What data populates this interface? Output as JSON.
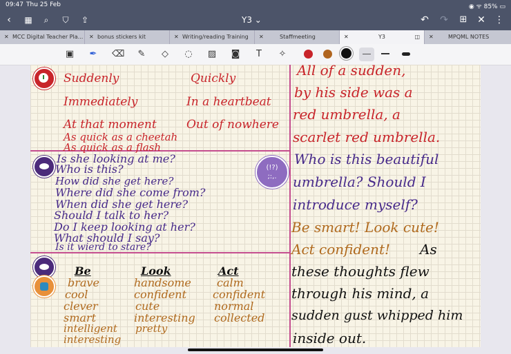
{
  "status": {
    "time": "09:47",
    "date": "Thu 25 Feb",
    "battery": "85%"
  },
  "toolbar": {
    "title": "Y3 ⌄"
  },
  "tabs": [
    {
      "label": "MCC Digital Teacher Pla..."
    },
    {
      "label": "bonus stickers kit"
    },
    {
      "label": "Writing/reading Training"
    },
    {
      "label": "Staffmeeting"
    },
    {
      "label": "Y3"
    },
    {
      "label": "MPQML NOTES"
    }
  ],
  "colors": {
    "red": "#c8242a",
    "brown": "#b0651f",
    "black": "#111111"
  },
  "left": {
    "openers_col1": [
      "Suddenly",
      "Immediately",
      "At that moment",
      "As quick as a cheetah",
      "As quick as a flash"
    ],
    "openers_col2": [
      "Quickly",
      "In a heartbeat",
      "Out of nowhere"
    ],
    "questions": [
      "Is she looking at me?",
      "Who is this?",
      "How did she get here?",
      "Where did she come from?",
      "When did she get here?",
      "Should I talk to her?",
      "Do I keep looking at her?",
      "What should I say?",
      "Is it wierd to stare?"
    ],
    "badge_text": "(!?)\n;:,.",
    "headers": [
      "Be",
      "Look",
      "Act"
    ],
    "be": [
      "brave",
      "cool",
      "clever",
      "smart",
      "intelligent",
      "interesting"
    ],
    "look": [
      "handsome",
      "confident",
      "cute",
      "interesting",
      "pretty"
    ],
    "act": [
      "calm",
      "confident",
      "normal",
      "collected"
    ]
  },
  "right": {
    "red_lines": [
      "All of a sudden,",
      "by his side was a",
      "red umbrella, a",
      "scarlet red umbrella."
    ],
    "purple_lines": [
      "Who is this beautiful",
      "umbrella? Should I",
      "introduce myself?"
    ],
    "gold_lines": [
      "Be smart! Look cute!",
      "Act confident!"
    ],
    "black_inline": "As",
    "black_lines": [
      "these thoughts flew",
      "through his mind, a",
      "sudden gust whipped him",
      "inside out."
    ]
  }
}
